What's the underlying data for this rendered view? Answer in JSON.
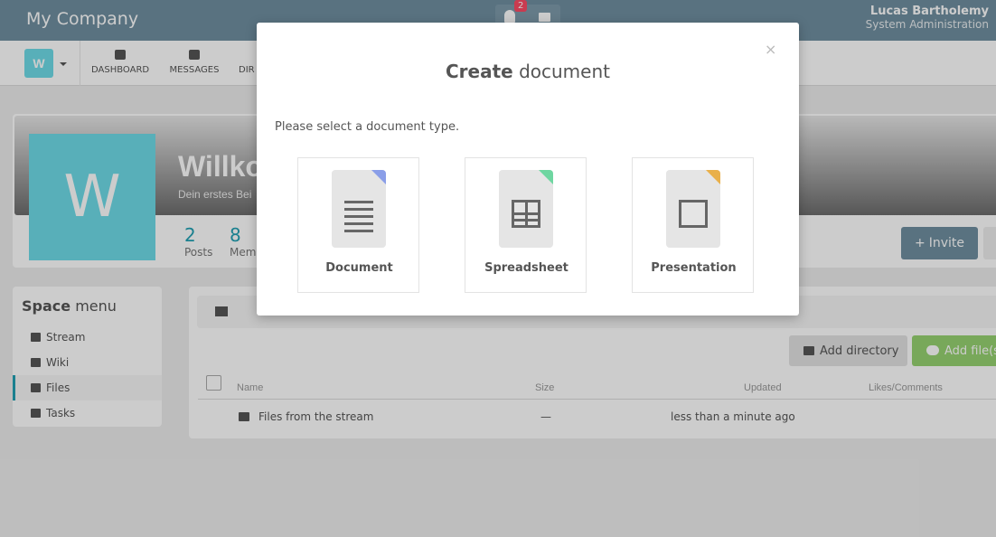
{
  "topbar": {
    "brand": "My Company",
    "notification_count": "2",
    "user_name": "Lucas Bartholemy",
    "user_role": "System Administration"
  },
  "navbar": {
    "space_initial": "W",
    "items": [
      {
        "label": "DASHBOARD",
        "icon": "dashboard-icon"
      },
      {
        "label": "MESSAGES",
        "icon": "envelope-icon"
      },
      {
        "label": "DIR",
        "icon": "directory-icon"
      }
    ]
  },
  "space": {
    "initial": "W",
    "title": "Willkommen",
    "subtitle": "Dein erstes Bei",
    "stats": [
      {
        "num": "2",
        "label": "Posts"
      },
      {
        "num": "8",
        "label": "Mem"
      }
    ],
    "invite_label": "Invite"
  },
  "space_menu": {
    "title_bold": "Space",
    "title_rest": "menu",
    "items": [
      {
        "label": "Stream",
        "icon": "bars-icon"
      },
      {
        "label": "Wiki",
        "icon": "book-icon"
      },
      {
        "label": "Files",
        "icon": "files-icon",
        "active": true
      },
      {
        "label": "Tasks",
        "icon": "check-square-icon"
      }
    ]
  },
  "files": {
    "add_directory": "Add directory",
    "add_files": "Add file(s",
    "columns": {
      "name": "Name",
      "size": "Size",
      "updated": "Updated",
      "likes": "Likes/Comments"
    },
    "rows": [
      {
        "name": "Files from the stream",
        "size": "—",
        "updated": "less than a minute ago"
      }
    ]
  },
  "modal": {
    "close": "×",
    "title_bold": "Create",
    "title_rest": "document",
    "prompt": "Please select a document type.",
    "types": [
      {
        "label": "Document",
        "accent": "#8a9ee8",
        "icon": "document-icon"
      },
      {
        "label": "Spreadsheet",
        "accent": "#6fd6a1",
        "icon": "spreadsheet-icon"
      },
      {
        "label": "Presentation",
        "accent": "#e9b04a",
        "icon": "presentation-icon"
      }
    ]
  },
  "colors": {
    "accent": "#21a1b3",
    "topbar": "#708fa0",
    "space_avatar": "#6fdbe8",
    "add_files": "#97d271"
  }
}
